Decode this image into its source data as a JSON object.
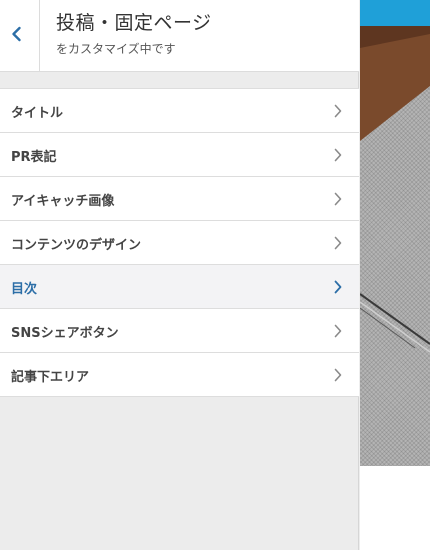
{
  "header": {
    "title": "投稿・固定ページ",
    "subtitle": "をカスタマイズ中です",
    "back_icon": "chevron-left-icon"
  },
  "menu": {
    "items": [
      {
        "label": "タイトル",
        "active": false
      },
      {
        "label": "PR表記",
        "active": false
      },
      {
        "label": "アイキャッチ画像",
        "active": false
      },
      {
        "label": "コンテンツのデザイン",
        "active": false
      },
      {
        "label": "目次",
        "active": true
      },
      {
        "label": "SNSシェアボタン",
        "active": false
      },
      {
        "label": "記事下エリア",
        "active": false
      }
    ],
    "item_icon": "chevron-right-icon"
  },
  "colors": {
    "accent": "#2c6ea7",
    "preview_bar": "#1fa0d8",
    "wood": "#7a4a2c"
  }
}
